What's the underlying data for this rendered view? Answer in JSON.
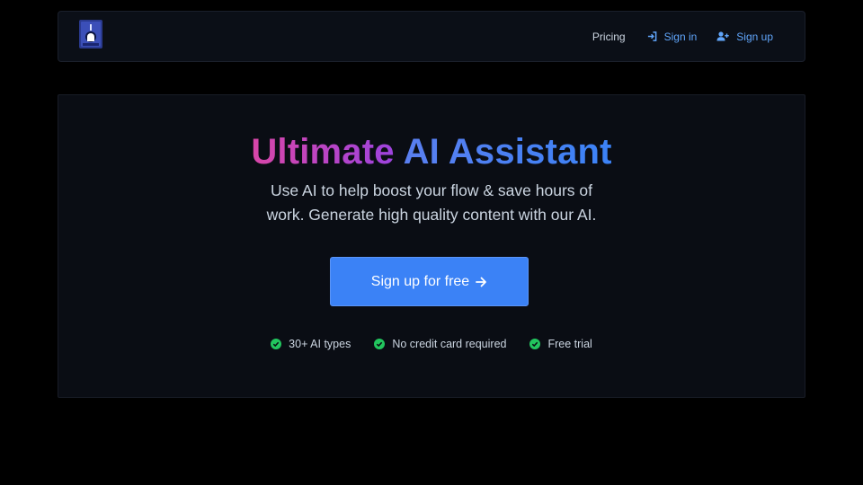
{
  "nav": {
    "logo_icon": "robot-hand-logo-icon",
    "pricing_label": "Pricing",
    "signin_label": "Sign in",
    "signin_icon": "sign-in-icon",
    "signup_label": "Sign up",
    "signup_icon": "user-plus-icon"
  },
  "hero": {
    "title_part1": "Ultimate",
    "title_part2": "AI Assistant",
    "subtitle_line1": "Use AI to help boost your flow & save hours of",
    "subtitle_line2": "work. Generate high quality content with our AI.",
    "cta_label": "Sign up for free",
    "cta_icon": "arrow-right-icon",
    "features": [
      {
        "label": "30+ AI types",
        "icon": "check-circle-icon"
      },
      {
        "label": "No credit card required",
        "icon": "check-circle-icon"
      },
      {
        "label": "Free trial",
        "icon": "check-circle-icon"
      }
    ]
  },
  "colors": {
    "accent": "#3b82f6",
    "link": "#60a5fa",
    "check": "#22c55e",
    "gradient_start": "#d946a8",
    "gradient_mid": "#9d43de",
    "gradient_end": "#3b82f6"
  }
}
